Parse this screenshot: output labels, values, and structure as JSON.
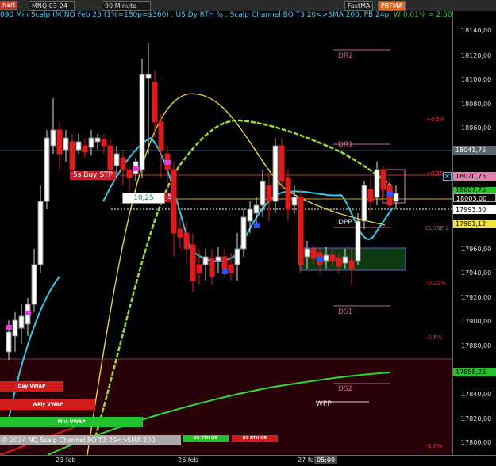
{
  "toolbar": {
    "chart_label": "hart",
    "symbol": "MNQ 03-24",
    "interval": "90 Minute",
    "fastma": "FastMA",
    "pbfma": "PBFMA"
  },
  "title": "090 Min Scalp (M)NQ Feb 25 (1%=180p=$360) , US Dy RTH % , Scalp Channel BO T3 20<>SMA 200, PB 24p",
  "title_right": "W 0,01% = 2,50",
  "levels": {
    "dr2": "DR2",
    "dr1": "DR1",
    "dpp": "DPP",
    "ds1": "DS1",
    "ds2": "DS2",
    "wpp": "WPP"
  },
  "pct_labels": {
    "p05": "+0.5%",
    "p025": "+0.25",
    "m025": "-0.25%",
    "m05": "-0.5%",
    "m10": "-1.0%"
  },
  "close_label": "CLOSE 2",
  "buy_stop": "5s  Buy STP",
  "val_box": "10,25",
  "val_box2": "5",
  "yaxis_ticks": [
    "18140,00",
    "18120,00",
    "18100,00",
    "18080,00",
    "18060,00",
    "17960,00",
    "17940,00",
    "17920,00",
    "17900,00",
    "17880,00",
    "17840,00",
    "17820,00",
    "17800,00"
  ],
  "price_boxes": {
    "p1": "18041,75",
    "p2": "18020,75",
    "p3": "18007,75",
    "p4": "18003,00",
    "p5": "17993,50",
    "p6": "17981,12",
    "p7": "17858,25"
  },
  "xaxis": {
    "d1": "23 feb",
    "d2": "26 feb",
    "d3": "27 feb",
    "t": "05:00"
  },
  "vwap": {
    "day": "Day VWAP",
    "wkly": "Wkly VWAP",
    "mnt": "Mnt VWAP"
  },
  "footer_strip": "© 2024 NQ Scalp Channel BO T3 20<>SMA 200",
  "rth": {
    "eth": "US ETH OR",
    "rth": "US RTH OR"
  },
  "colors": {
    "bull": "#ffffff",
    "bear": "#e01b1b",
    "fast_ma": "#35c8e8",
    "slow_ma": "#9bdc2c",
    "yellow": "#e6d33a",
    "green_ma": "#2cdc2c"
  }
}
